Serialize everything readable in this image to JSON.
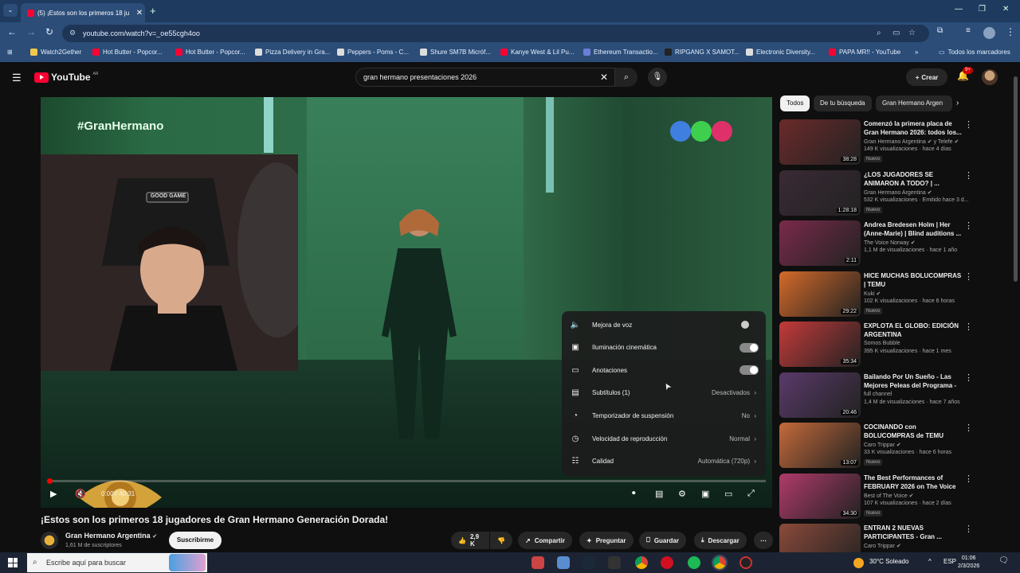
{
  "browser": {
    "tab_title": "(5) ¡Estos son los primeros 18 ju",
    "url": "youtube.com/watch?v=_oe55cgh4oo",
    "bookmarks": [
      {
        "label": "Watch2Gether",
        "color": "#f2c94c"
      },
      {
        "label": "Hot Butter - Popcor...",
        "color": "#ff0033"
      },
      {
        "label": "Hot Butter - Popcor...",
        "color": "#ff0033"
      },
      {
        "label": "Pizza Delivery in Gra...",
        "color": "#dddddd"
      },
      {
        "label": "Peppers - Poms - C...",
        "color": "#dddddd"
      },
      {
        "label": "Shure SM7B Micróf...",
        "color": "#dddddd"
      },
      {
        "label": "Kanye West & Lil Pu...",
        "color": "#ff0033"
      },
      {
        "label": "Ethereum Transactio...",
        "color": "#6b7fd7"
      },
      {
        "label": "RIPGANG X SAMOT...",
        "color": "#222222"
      },
      {
        "label": "Electronic Diversity...",
        "color": "#dddddd"
      },
      {
        "label": "PAPA MR!! - YouTube",
        "color": "#ff0033"
      }
    ],
    "all_bookmarks": "Todos los marcadores"
  },
  "youtube": {
    "logo_text": "YouTube",
    "country": "AR",
    "search_query": "gran hermano presentaciones 2026",
    "create_label": "Crear",
    "notif_count": "9+"
  },
  "player": {
    "hashtag": "#GranHermano",
    "webcam_cap_text": "GOOD GAME",
    "time": "0:00 / 40:31",
    "progress": 0.0
  },
  "settings_menu": [
    {
      "icon": "voice-icon",
      "label": "Mejora de voz",
      "type": "toggle",
      "on": false
    },
    {
      "icon": "ambient-icon",
      "label": "Iluminación cinemática",
      "type": "toggle",
      "on": true
    },
    {
      "icon": "annotations-icon",
      "label": "Anotaciones",
      "type": "toggle",
      "on": true
    },
    {
      "icon": "subtitles-icon",
      "label": "Subtítulos (1)",
      "type": "value",
      "value": "Desactivados"
    },
    {
      "icon": "sleep-timer-icon",
      "label": "Temporizador de suspensión",
      "type": "value",
      "value": "No"
    },
    {
      "icon": "speed-icon",
      "label": "Velocidad de reproducción",
      "type": "value",
      "value": "Normal"
    },
    {
      "icon": "quality-icon",
      "label": "Calidad",
      "type": "value",
      "value": "Automática (720p)"
    }
  ],
  "video": {
    "title": "¡Estos son los primeros 18 jugadores de Gran Hermano Generación Dorada!",
    "channel": "Gran Hermano Argentina",
    "subscribers": "1,61 M de suscriptores",
    "subscribe_label": "Suscribirme",
    "likes": "2,9 K",
    "share_label": "Compartir",
    "ask_label": "Preguntar",
    "save_label": "Guardar",
    "download_label": "Descargar"
  },
  "chips": [
    "Todos",
    "De tu búsqueda",
    "Gran Hermano Argen"
  ],
  "recommendations": [
    {
      "title": "Comenzó la primera placa de Gran Hermano 2026: todos los...",
      "channel": "Gran Hermano Argentina ✔ y Telefe ✔",
      "meta": "149 K visualizaciones · hace 4 días",
      "badge": "Nuevo",
      "duration": "38:28",
      "color": "#6b2a2a"
    },
    {
      "title": "¿LOS JUGADORES SE ANIMARON A TODO? | ...",
      "channel": "Gran Hermano Argentina ✔",
      "meta": "532 K visualizaciones · Emitido hace 3 d...",
      "badge": "Nuevo",
      "duration": "1:28:18",
      "color": "#3a2a35"
    },
    {
      "title": "Andrea Bredesen Holm | Her (Anne-Marie) | Blind auditions ...",
      "channel": "The Voice Norway ✔",
      "meta": "1,1 M de visualizaciones · hace 1 año",
      "badge": "",
      "duration": "2:11",
      "color": "#7a2a4a"
    },
    {
      "title": "HICE MUCHAS BOLUCOMPRAS | TEMU",
      "channel": "Kuki ✔",
      "meta": "102 K visualizaciones · hace 6 horas",
      "badge": "Nuevo",
      "duration": "29:22",
      "color": "#d46a2a"
    },
    {
      "title": "EXPLOTA EL GLOBO: EDICIÓN ARGENTINA",
      "channel": "Somos Bubble",
      "meta": "395 K visualizaciones · hace 1 mes",
      "badge": "",
      "duration": "35:34",
      "color": "#c43a3a"
    },
    {
      "title": "Bailando Por Un Sueño - Las Mejores Peleas del Programa - ...",
      "channel": "full channel",
      "meta": "1,4 M de visualizaciones · hace 7 años",
      "badge": "",
      "duration": "20:46",
      "color": "#5a3a6a"
    },
    {
      "title": "COCINANDO con BOLUCOMPRAS de TEMU",
      "channel": "Caro Trippar ✔",
      "meta": "33 K visualizaciones · hace 6 horas",
      "badge": "Nuevo",
      "duration": "13:07",
      "color": "#c46a3a"
    },
    {
      "title": "The Best Performances of FEBRUARY 2026 on The Voice ...",
      "channel": "Best of The Voice ✔",
      "meta": "107 K visualizaciones · hace 2 días",
      "badge": "Nuevo",
      "duration": "34:30",
      "color": "#b03a6a"
    },
    {
      "title": "ENTRAN 2 NUEVAS PARTICIPANTES - Gran ...",
      "channel": "Caro Trippar ✔",
      "meta": "",
      "badge": "",
      "duration": "",
      "color": "#8a4a3a"
    }
  ],
  "taskbar": {
    "search_placeholder": "Escribe aquí para buscar",
    "weather": "30°C Soleado",
    "lang": "ESP",
    "time": "01:06",
    "date": "2/3/2026"
  }
}
